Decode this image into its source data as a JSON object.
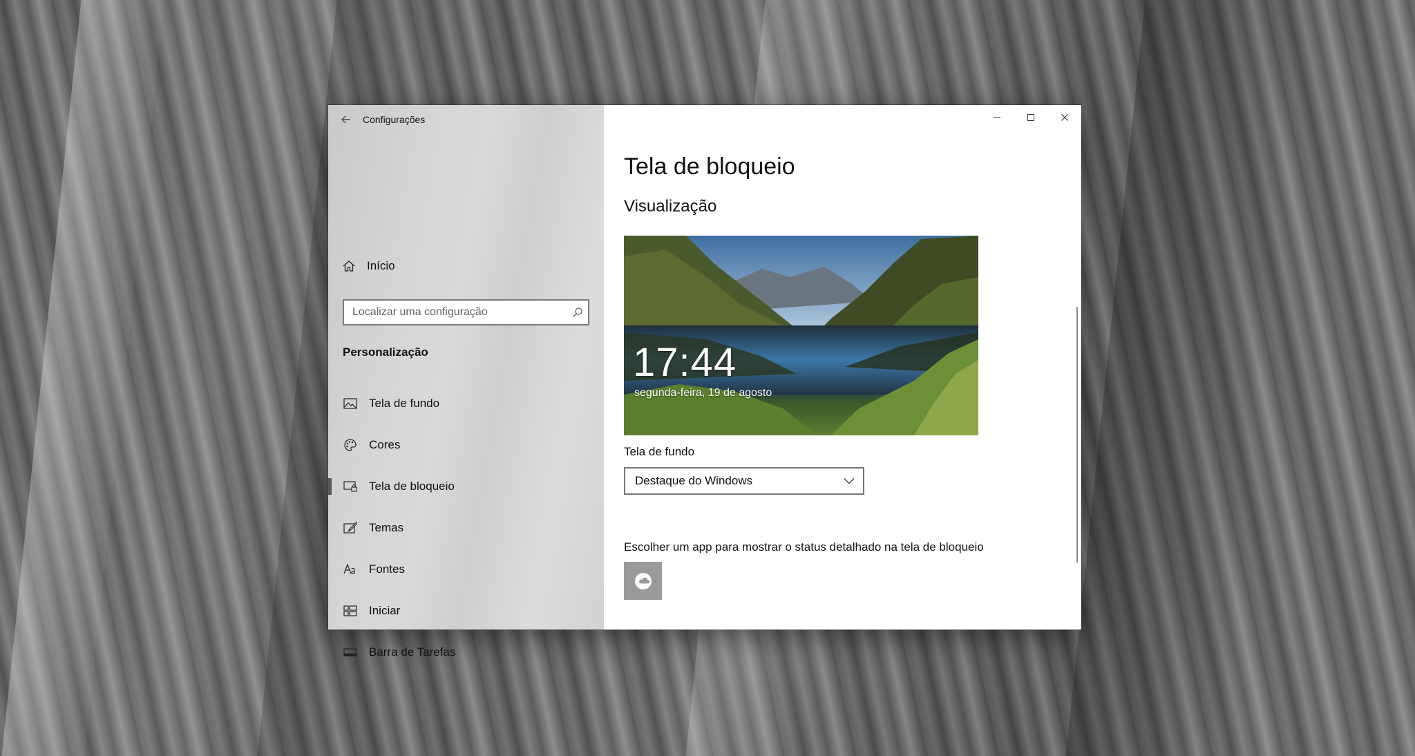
{
  "window": {
    "app_title": "Configurações"
  },
  "sidebar": {
    "home_label": "Início",
    "search_placeholder": "Localizar uma configuração",
    "section_title": "Personalização",
    "items": [
      {
        "label": "Tela de fundo",
        "icon": "image-icon"
      },
      {
        "label": "Cores",
        "icon": "palette-icon"
      },
      {
        "label": "Tela de bloqueio",
        "icon": "lock-screen-icon",
        "selected": true
      },
      {
        "label": "Temas",
        "icon": "brush-icon"
      },
      {
        "label": "Fontes",
        "icon": "font-icon"
      },
      {
        "label": "Iniciar",
        "icon": "start-icon"
      },
      {
        "label": "Barra de Tarefas",
        "icon": "taskbar-icon"
      }
    ]
  },
  "content": {
    "page_title": "Tela de bloqueio",
    "preview_heading": "Visualização",
    "preview": {
      "time": "17:44",
      "date": "segunda-feira, 19 de agosto"
    },
    "background_label": "Tela de fundo",
    "background_value": "Destaque do Windows",
    "status_app_label": "Escolher um app para mostrar o status detalhado na tela de bloqueio",
    "status_app_icon": "weather-icon"
  },
  "colors": {
    "sidebar_bg": "#d3d3d3",
    "content_bg": "#ffffff",
    "selection_bar": "#5a5a5a",
    "app_tile": "#9a9a9a"
  }
}
